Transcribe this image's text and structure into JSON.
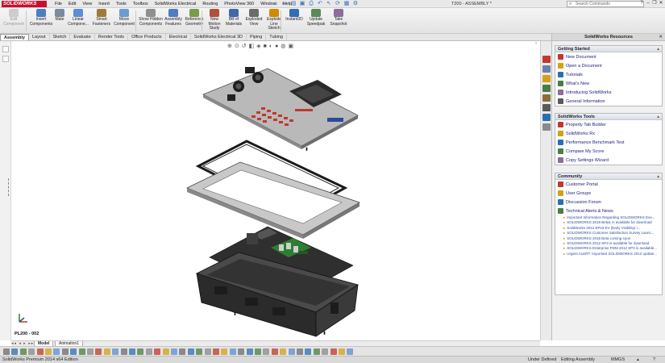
{
  "app": {
    "logo_text": "SOLIDWORKS",
    "document_title": "T200 - ASSEMBLY *",
    "search_placeholder": "Search Commands"
  },
  "menu": [
    "File",
    "Edit",
    "View",
    "Insert",
    "Tools",
    "Toolbox",
    "SolidWorks Electrical",
    "Routing",
    "PhotoView 360",
    "Window",
    "Help"
  ],
  "ribbon": {
    "buttons": [
      {
        "label": "Edit Component",
        "disabled": true
      },
      {
        "label": "Insert Components"
      },
      {
        "label": "Mate"
      },
      {
        "label": "Linear Compone..."
      },
      {
        "label": "Smart Fasteners"
      },
      {
        "label": "Move Component"
      },
      {
        "label": "Show Hidden Components"
      },
      {
        "label": "Assembly Features"
      },
      {
        "label": "Reference Geometry"
      },
      {
        "label": "New Motion Study"
      },
      {
        "label": "Bill of Materials"
      },
      {
        "label": "Exploded View"
      },
      {
        "label": "Explode Line Sketch"
      },
      {
        "label": "Instant3D"
      },
      {
        "label": "Update Speedpak"
      },
      {
        "label": "Take Snapshot"
      }
    ]
  },
  "tabs": [
    {
      "label": "Assembly",
      "active": true
    },
    {
      "label": "Layout"
    },
    {
      "label": "Sketch"
    },
    {
      "label": "Evaluate"
    },
    {
      "label": "Render Tools"
    },
    {
      "label": "Office Products"
    },
    {
      "label": "Electrical"
    },
    {
      "label": "SolidWorks Electrical 3D"
    },
    {
      "label": "Piping"
    },
    {
      "label": "Tubing"
    }
  ],
  "graphics": {
    "part_label": "PL200 - 002"
  },
  "task_pane": {
    "title": "SolidWorks Resources",
    "getting_started": {
      "title": "Getting Started",
      "items": [
        "New Document",
        "Open a Document",
        "Tutorials",
        "What's New",
        "Introducing SolidWorks",
        "General Information"
      ]
    },
    "tools": {
      "title": "SolidWorks Tools",
      "items": [
        "Property Tab Builder",
        "SolidWorks Rx",
        "Performance Benchmark Test",
        "Compare My Score",
        "Copy Settings Wizard"
      ]
    },
    "community": {
      "title": "Community",
      "items": [
        "Customer Portal",
        "User Groups",
        "Discussion Forum",
        "Technical Alerts & News"
      ],
      "alerts": [
        "Important Information Regarding SOLIDWORKS Eve...",
        "SOLIDWORKS 2018 Beta1 is available for download",
        "SolidWorks 2012 EPx3 EV (Early Visibility) i...",
        "SOLIDWORKS Customer Satisfaction Survey Launc...",
        "SOLIDWORKS 2018 Beta coming soon",
        "SOLIDWORKS 2012 SP3 is available for download",
        "SOLIDWORKS Enterprise PDM 2012 SP3 is available...",
        "Urgent ALERT: Important SOLIDWORKS 2012 update..."
      ]
    }
  },
  "model_tabs": [
    {
      "label": "Model",
      "active": true
    },
    {
      "label": "Animation1"
    }
  ],
  "status": {
    "edition": "SolidWorks Premium 2014 x64 Edition",
    "definition": "Under Defined",
    "mode": "Editing Assembly",
    "units": "MMGS"
  },
  "colors": {
    "brand_red": "#c8102e",
    "link_blue": "#1a1a7a"
  }
}
